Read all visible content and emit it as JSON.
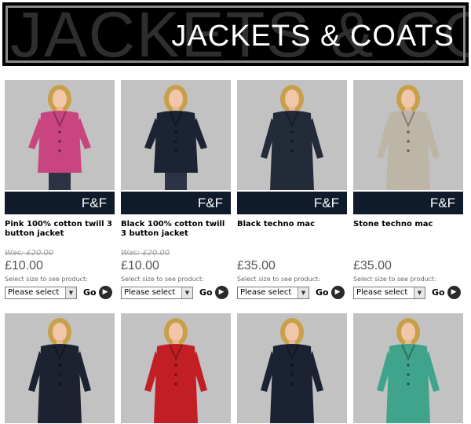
{
  "banner": {
    "background_text": "JACKETS & CO",
    "title": "JACKETS & COATS"
  },
  "products": [
    {
      "brand": "F&F",
      "name": "Pink 100% cotton twill 3 button jacket",
      "was": "Was: £20.00",
      "price": "£10.00",
      "size_label": "Select size to see product:",
      "select_value": "Please select",
      "go_label": "Go",
      "coat_color": "#c9457f"
    },
    {
      "brand": "F&F",
      "name": "Black 100% cotton twill 3 button jacket",
      "was": "Was: £20.00",
      "price": "£10.00",
      "size_label": "Select size to see product:",
      "select_value": "Please select",
      "go_label": "Go",
      "coat_color": "#1c2433"
    },
    {
      "brand": "F&F",
      "name": "Black techno mac",
      "was": "",
      "price": "£35.00",
      "size_label": "Select size to see product:",
      "select_value": "Please select",
      "go_label": "Go",
      "coat_color": "#232a38"
    },
    {
      "brand": "F&F",
      "name": "Stone techno mac",
      "was": "",
      "price": "£35.00",
      "size_label": "Select size to see product:",
      "select_value": "Please select",
      "go_label": "Go",
      "coat_color": "#bdb5a6"
    }
  ],
  "lower_products": [
    {
      "coat_color": "#1d2230"
    },
    {
      "coat_color": "#c21f24"
    },
    {
      "coat_color": "#1b2232"
    },
    {
      "coat_color": "#3fa48b"
    }
  ],
  "icons": {
    "select_arrow": "chevron-down-icon",
    "go_arrow": "arrow-right-icon"
  }
}
